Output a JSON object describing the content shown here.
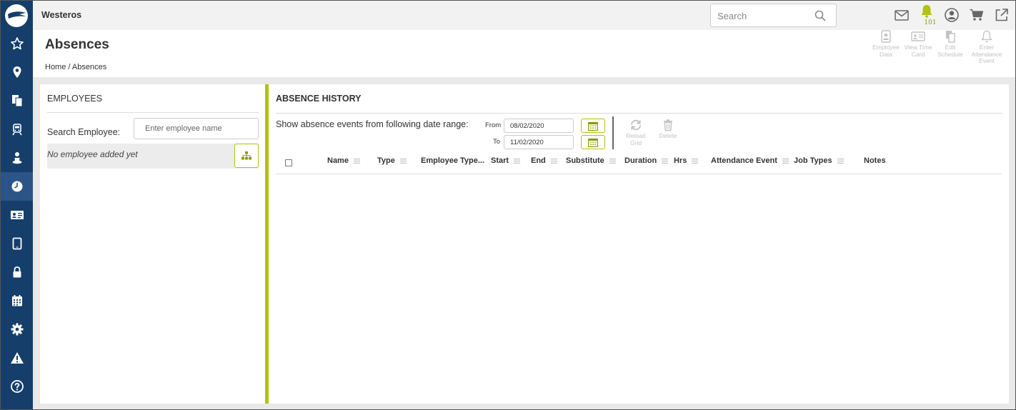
{
  "app": {
    "name": "Westeros"
  },
  "search": {
    "placeholder": "Search"
  },
  "notifications": {
    "count": "101"
  },
  "page": {
    "title": "Absences"
  },
  "breadcrumb": {
    "home": "Home",
    "separator": "/",
    "current": "Absences"
  },
  "actions": [
    {
      "label": "Employee Data",
      "icon": "employee-data-icon"
    },
    {
      "label": "View Time Card",
      "icon": "time-card-icon"
    },
    {
      "label": "Edit Schedule",
      "icon": "edit-schedule-icon"
    },
    {
      "label": "Enter Attendance Event",
      "icon": "bell-icon"
    }
  ],
  "sidebar": {
    "items": [
      {
        "icon": "star-icon"
      },
      {
        "icon": "map-pin-icon"
      },
      {
        "icon": "documents-icon"
      },
      {
        "icon": "train-icon"
      },
      {
        "icon": "person-icon"
      },
      {
        "icon": "clock-icon",
        "active": true
      },
      {
        "icon": "id-card-icon"
      },
      {
        "icon": "tablet-icon"
      },
      {
        "icon": "lock-icon"
      },
      {
        "icon": "calendar-icon"
      },
      {
        "icon": "gear-icon"
      },
      {
        "icon": "warning-icon"
      },
      {
        "icon": "help-icon"
      }
    ]
  },
  "employees": {
    "title": "EMPLOYEES",
    "search_label": "Search Employee:",
    "search_placeholder": "Enter employee name",
    "empty_text": "No employee added yet"
  },
  "absence": {
    "title": "ABSENCE HISTORY",
    "range_label": "Show absence events from following date range:",
    "from_label": "From",
    "to_label": "To",
    "from_value": "08/02/2020",
    "to_value": "11/02/2020",
    "reload_label": "Reload Grid",
    "delete_label": "Delete",
    "columns": [
      "Name",
      "Type",
      "Employee Type...",
      "Start",
      "End",
      "Substitute",
      "Duration",
      "Hrs",
      "Attendance Event",
      "Job Types",
      "Notes"
    ]
  },
  "colors": {
    "sidebar": "#153e6b",
    "sidebar_active": "#2c5587",
    "accent": "#b2c210"
  }
}
